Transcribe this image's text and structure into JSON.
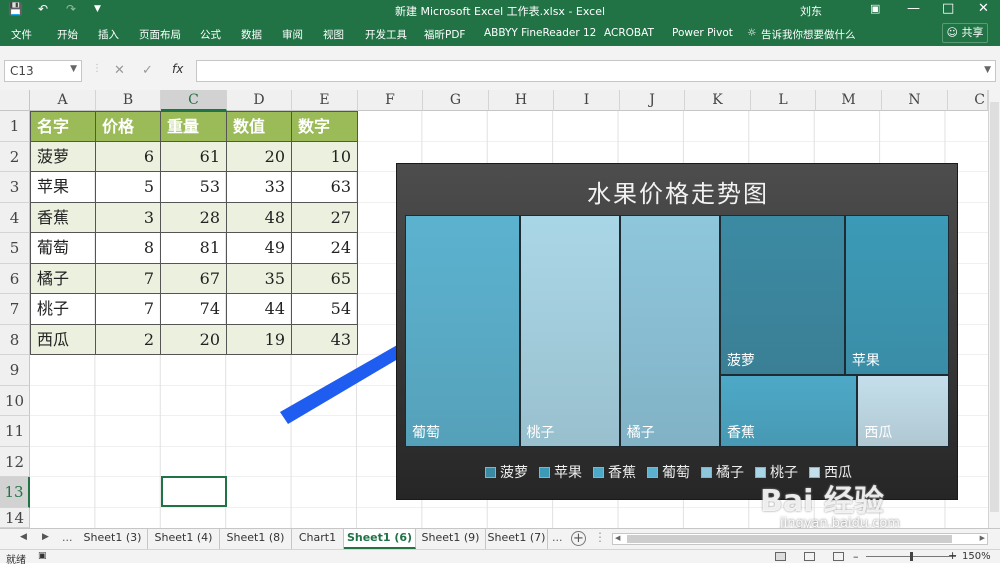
{
  "window": {
    "title": "新建 Microsoft Excel 工作表.xlsx  -  Excel",
    "user": "刘东"
  },
  "ribbon": {
    "tabs": [
      "文件",
      "开始",
      "插入",
      "页面布局",
      "公式",
      "数据",
      "审阅",
      "视图",
      "开发工具",
      "福昕PDF",
      "ABBYY FineReader 12",
      "ACROBAT",
      "Power Pivot"
    ],
    "tell_me": "告诉我你想要做什么",
    "share": "共享"
  },
  "formula_bar": {
    "name_box": "C13",
    "fx": "fx",
    "value": ""
  },
  "columns": [
    "A",
    "B",
    "C",
    "D",
    "E",
    "F",
    "G",
    "H",
    "I",
    "J",
    "K",
    "L",
    "M",
    "N",
    "C"
  ],
  "rows": [
    "1",
    "2",
    "3",
    "4",
    "5",
    "6",
    "7",
    "8",
    "9",
    "10",
    "11",
    "12",
    "13",
    "14"
  ],
  "table": {
    "headers": [
      "名字",
      "价格",
      "重量",
      "数值",
      "数字"
    ],
    "rows": [
      [
        "菠萝",
        "6",
        "61",
        "20",
        "10"
      ],
      [
        "苹果",
        "5",
        "53",
        "33",
        "63"
      ],
      [
        "香蕉",
        "3",
        "28",
        "48",
        "27"
      ],
      [
        "葡萄",
        "8",
        "81",
        "49",
        "24"
      ],
      [
        "橘子",
        "7",
        "67",
        "35",
        "65"
      ],
      [
        "桃子",
        "7",
        "74",
        "44",
        "54"
      ],
      [
        "西瓜",
        "2",
        "20",
        "19",
        "43"
      ]
    ]
  },
  "chart_data": {
    "type": "treemap",
    "title": "水果价格走势图",
    "categories": [
      "菠萝",
      "苹果",
      "香蕉",
      "葡萄",
      "橘子",
      "桃子",
      "西瓜"
    ],
    "values": [
      6,
      5,
      3,
      8,
      7,
      7,
      2
    ],
    "legend": [
      "菠萝",
      "苹果",
      "香蕉",
      "葡萄",
      "橘子",
      "桃子",
      "西瓜"
    ],
    "legend_position": "bottom",
    "colors": {
      "葡萄": "#5bb2cf",
      "桃子": "#a9d6e6",
      "橘子": "#8ec6dc",
      "菠萝": "#3b8aa3",
      "苹果": "#3b9ab7",
      "香蕉": "#4ca9c7",
      "西瓜": "#c4dfeb"
    }
  },
  "sheet_tabs": [
    "Sheet1 (3)",
    "Sheet1 (4)",
    "Sheet1 (8)",
    "Chart1",
    "Sheet1 (6)",
    "Sheet1 (9)",
    "Sheet1 (7)"
  ],
  "active_sheet": "Sheet1 (6)",
  "more": "...",
  "status": {
    "ready": "就绪",
    "zoom": "150%"
  },
  "watermark": {
    "logo": "Bai 经验",
    "url": "jingyan.baidu.com"
  },
  "accent_color": "#217346"
}
